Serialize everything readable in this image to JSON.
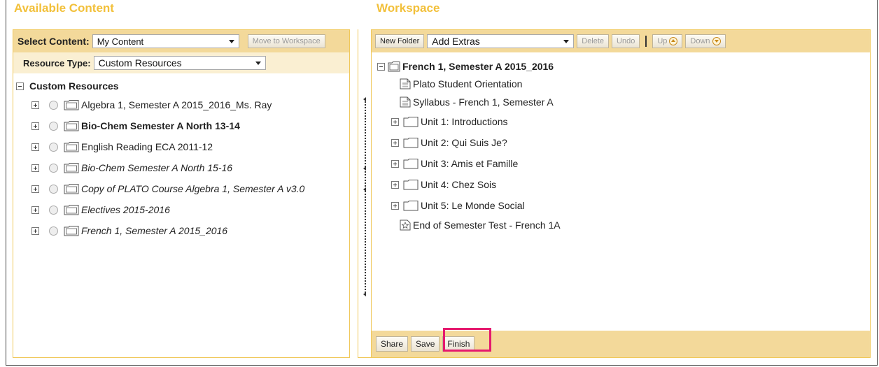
{
  "left": {
    "heading": "Available Content",
    "select_content_label": "Select Content:",
    "select_content_value": "My Content",
    "move_button": "Move to Workspace",
    "resource_type_label": "Resource Type:",
    "resource_type_value": "Custom Resources",
    "root_label": "Custom Resources",
    "items": [
      {
        "label": "Algebra 1, Semester A 2015_2016_Ms. Ray",
        "style": "normal"
      },
      {
        "label": "Bio-Chem Semester A North 13-14",
        "style": "bold"
      },
      {
        "label": "English Reading ECA 2011-12",
        "style": "normal"
      },
      {
        "label": "Bio-Chem Semester A North 15-16",
        "style": "italic"
      },
      {
        "label": "Copy of PLATO Course Algebra 1, Semester A v3.0",
        "style": "italic"
      },
      {
        "label": "Electives 2015-2016",
        "style": "italic"
      },
      {
        "label": "French 1, Semester A 2015_2016",
        "style": "italic"
      }
    ]
  },
  "right": {
    "heading": "Workspace",
    "new_folder": "New Folder",
    "add_extras": "Add Extras",
    "delete": "Delete",
    "undo": "Undo",
    "up": "Up",
    "down": "Down",
    "root_label": "French 1, Semester A 2015_2016",
    "docs": [
      "Plato Student Orientation",
      "Syllabus - French 1, Semester A"
    ],
    "units": [
      "Unit 1: Introductions",
      "Unit 2: Qui Suis Je?",
      "Unit 3: Amis et Famille",
      "Unit 4: Chez Sois",
      "Unit 5: Le Monde Social"
    ],
    "test": "End of Semester Test - French 1A",
    "share": "Share",
    "save": "Save",
    "finish": "Finish"
  },
  "colors": {
    "heading": "#f2c03a",
    "toolbar": "#f3d99a",
    "highlight": "#e5196e"
  }
}
